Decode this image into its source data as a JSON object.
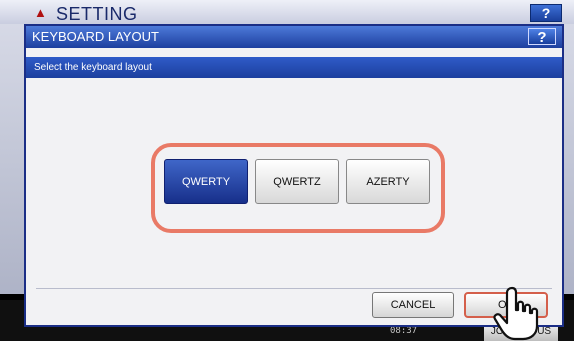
{
  "background": {
    "title": "SETTING",
    "help_label": "?",
    "clock": "08:37",
    "jobs_label": "JOB STATUS"
  },
  "modal": {
    "title": "KEYBOARD LAYOUT",
    "help_label": "?",
    "instruction": "Select the keyboard layout",
    "layouts": [
      {
        "label": "QWERTY",
        "selected": true
      },
      {
        "label": "QWERTZ",
        "selected": false
      },
      {
        "label": "AZERTY",
        "selected": false
      }
    ],
    "cancel_label": "CANCEL",
    "ok_label": "OK"
  },
  "colors": {
    "header_blue": "#1d3f9f",
    "selected_blue": "#172f8a",
    "highlight": "#e97a66"
  }
}
